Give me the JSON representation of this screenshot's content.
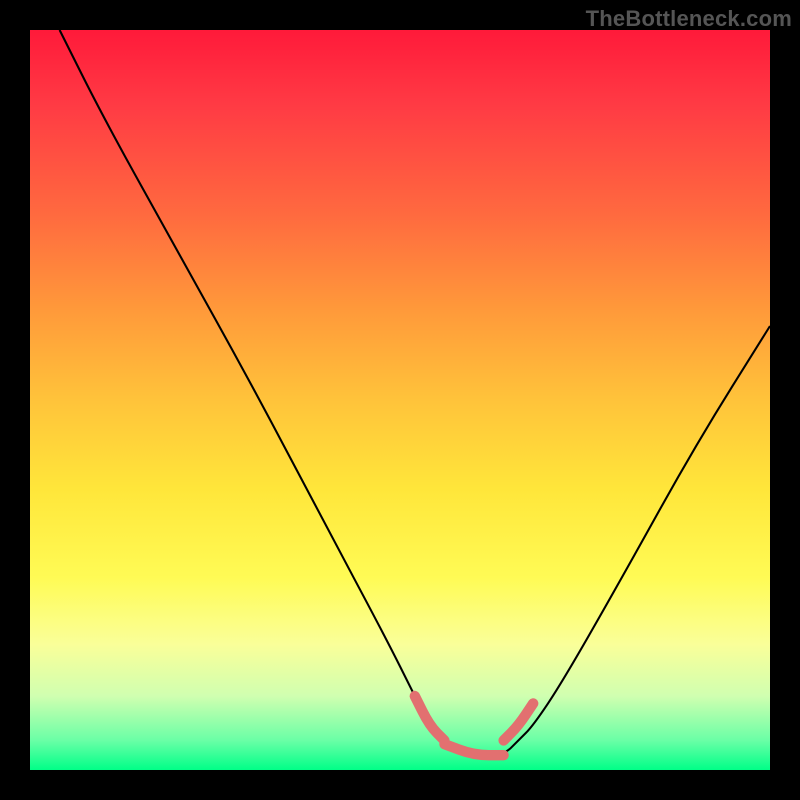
{
  "watermark": "TheBottleneck.com",
  "chart_data": {
    "type": "line",
    "title": "",
    "xlabel": "",
    "ylabel": "",
    "xlim": [
      0,
      100
    ],
    "ylim": [
      0,
      100
    ],
    "series": [
      {
        "name": "curve",
        "color": "#000000",
        "width": 1.4,
        "x": [
          4,
          10,
          20,
          30,
          40,
          48,
          52,
          54,
          56,
          60,
          64,
          66,
          68,
          72,
          80,
          90,
          100
        ],
        "y": [
          100,
          88,
          70,
          52,
          33,
          18,
          10,
          6,
          4,
          2,
          2,
          4,
          6,
          12,
          26,
          44,
          60
        ]
      },
      {
        "name": "valley-accent",
        "color": "#e27070",
        "width": 7,
        "linecap": "round",
        "segments": [
          {
            "x": [
              52,
              54,
              56
            ],
            "y": [
              10,
              6,
              4
            ]
          },
          {
            "x": [
              56,
              60,
              64
            ],
            "y": [
              3.5,
              2,
              2
            ]
          },
          {
            "x": [
              64,
              66,
              68
            ],
            "y": [
              4,
              6,
              9
            ]
          }
        ]
      }
    ],
    "background_gradient": [
      {
        "stop": 0.0,
        "color": "#ff1a3a"
      },
      {
        "stop": 0.1,
        "color": "#ff3a44"
      },
      {
        "stop": 0.25,
        "color": "#ff6a3f"
      },
      {
        "stop": 0.38,
        "color": "#ff9a3a"
      },
      {
        "stop": 0.5,
        "color": "#ffc33a"
      },
      {
        "stop": 0.62,
        "color": "#ffe63a"
      },
      {
        "stop": 0.74,
        "color": "#fffb55"
      },
      {
        "stop": 0.83,
        "color": "#faff99"
      },
      {
        "stop": 0.9,
        "color": "#d0ffb0"
      },
      {
        "stop": 0.96,
        "color": "#6affa6"
      },
      {
        "stop": 1.0,
        "color": "#00ff88"
      }
    ]
  }
}
